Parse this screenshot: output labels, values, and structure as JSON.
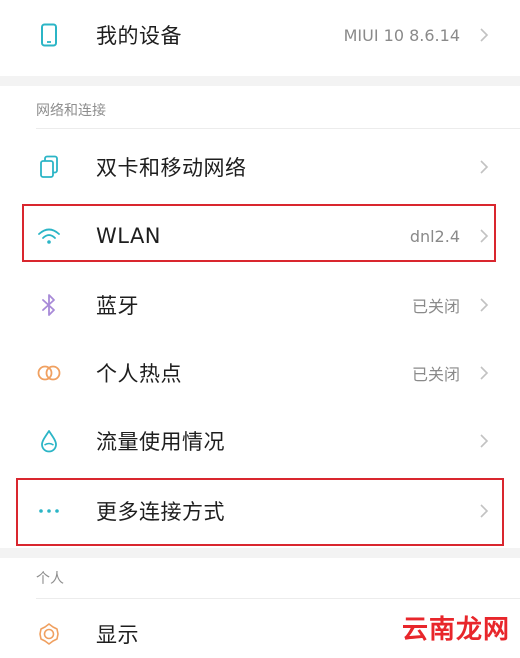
{
  "top": {
    "device_label": "我的设备",
    "device_value": "MIUI 10 8.6.14"
  },
  "section_network": {
    "title": "网络和连接",
    "items": [
      {
        "label": "双卡和移动网络",
        "value": "",
        "icon": "sim-cards-icon"
      },
      {
        "label": "WLAN",
        "value": "dnl2.4",
        "icon": "wifi-icon"
      },
      {
        "label": "蓝牙",
        "value": "已关闭",
        "icon": "bluetooth-icon"
      },
      {
        "label": "个人热点",
        "value": "已关闭",
        "icon": "hotspot-icon"
      },
      {
        "label": "流量使用情况",
        "value": "",
        "icon": "data-drop-icon"
      },
      {
        "label": "更多连接方式",
        "value": "",
        "icon": "more-dots-icon"
      }
    ]
  },
  "section_personal": {
    "title": "个人",
    "items": [
      {
        "label": "显示",
        "value": "",
        "icon": "display-sun-icon"
      }
    ]
  },
  "watermark": "云南龙网",
  "colors": {
    "highlight": "#d9262e",
    "accent_teal": "#2bb5c6",
    "bluetooth_purple": "#a88ad8",
    "hotspot_orange": "#f0a060",
    "background_gap": "#f3f3f3"
  }
}
